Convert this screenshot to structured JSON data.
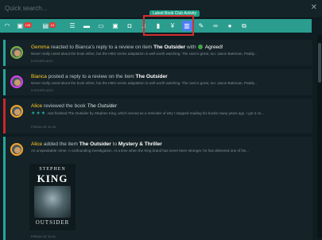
{
  "search": {
    "placeholder": "Quick search..."
  },
  "tooltip": "Latest Book Club Activity",
  "iconbar": {
    "badges": {
      "notifications": "138",
      "messages": "15"
    }
  },
  "feed": [
    {
      "actor": "Gemma",
      "action": "reacted to Bianca's reply to a review on item",
      "target": "The Outsider",
      "suffix": "with",
      "reaction": "Agreed!",
      "preview": "Never really cared about the book either, but the HBO series adaptation is well worth watching. The cast is great, too: Jason Bateman, Paddy...",
      "time": "5 HOURS AGO"
    },
    {
      "actor": "Bianca",
      "action": "posted a reply to a review on the item",
      "target": "The Outsider",
      "preview": "Never really cared about the book either, but the HBO series adaptation is well worth watching. The cast is great, too: Jason Bateman, Paddy...",
      "time": "5 HOURS AGO"
    },
    {
      "actor": "Alice",
      "action": "reviewed the book",
      "target": "The Outsider",
      "rating": "★★★",
      "preview": "Just finished The Outsider by Stephen King, which served as a reminder of why I stopped reading his books many years ago. I got it on...",
      "time": "FRIDAY AT 22:44"
    },
    {
      "actor": "Alice",
      "action": "added the item",
      "target": "The Outsider",
      "suffix": "to",
      "category": "Mystery & Thriller",
      "preview": "An unspeakable crime. A confounding investigation. At a time when the King brand has never been stronger, he has delivered one of his...",
      "cover": {
        "author_first": "STEPHEN",
        "author_last": "KING",
        "title": "OUTSIDER"
      },
      "time": "FRIDAY AT 22:01"
    }
  ]
}
